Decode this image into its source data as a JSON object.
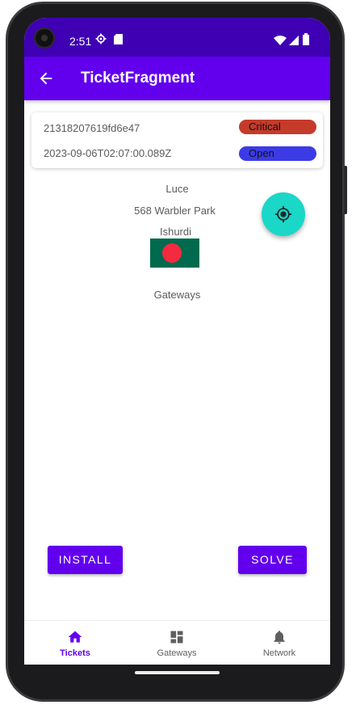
{
  "colors": {
    "status_bar": "#3f00b4",
    "primary": "#6200ee",
    "fab": "#1ad7c8",
    "critical": "#c53b2a",
    "open": "#3b3be6"
  },
  "status_bar": {
    "time": "2:51"
  },
  "app_bar": {
    "title": "TicketFragment",
    "back_icon": "arrow-back-icon"
  },
  "ticket": {
    "id": "21318207619fd6e47",
    "timestamp": "2023-09-06T02:07:00.089Z",
    "severity": "Critical",
    "status": "Open"
  },
  "details": {
    "name": "Luce",
    "street": "568 Warbler Park",
    "city": "Ishurdi",
    "flag": "bangladesh-flag",
    "section": "Gateways"
  },
  "actions": {
    "install": "INSTALL",
    "solve": "SOLVE"
  },
  "bottom_nav": {
    "items": [
      {
        "label": "Tickets",
        "icon": "home-icon",
        "selected": true
      },
      {
        "label": "Gateways",
        "icon": "dashboard-icon",
        "selected": false
      },
      {
        "label": "Network",
        "icon": "bell-icon",
        "selected": false
      }
    ]
  }
}
